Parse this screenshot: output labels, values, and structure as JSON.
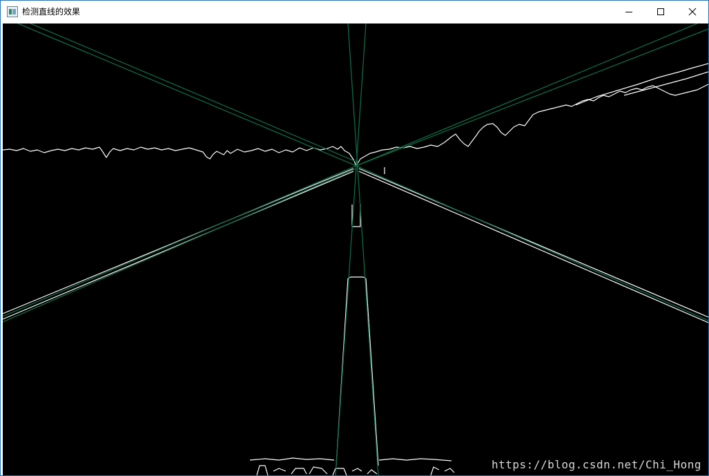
{
  "window": {
    "title": "检测直线的效果",
    "app_icon": "opencv-window-icon",
    "controls": [
      "minimize-icon",
      "maximize-icon",
      "close-icon"
    ]
  },
  "image": {
    "background_color": "#000000",
    "edge_color": "#ffffff",
    "line_color": "#0f6b45"
  },
  "watermark": "https://blog.csdn.net/Chi_Hong"
}
